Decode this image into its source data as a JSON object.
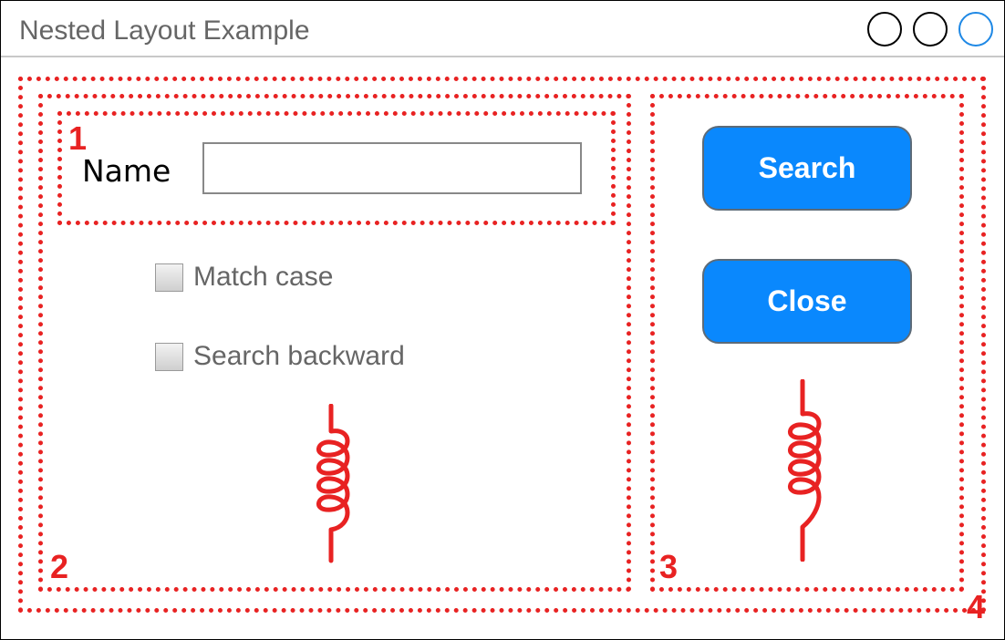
{
  "window": {
    "title": "Nested Layout Example"
  },
  "regions": {
    "region1_label": "1",
    "region2_label": "2",
    "region3_label": "3",
    "region4_label": "4"
  },
  "form": {
    "name_label": "Name",
    "name_value": "",
    "match_case_label": "Match case",
    "match_case_checked": false,
    "search_backward_label": "Search backward",
    "search_backward_checked": false
  },
  "buttons": {
    "search_label": "Search",
    "close_label": "Close"
  },
  "colors": {
    "annotation": "#e82222",
    "button": "#0a88fd",
    "active_window_control": "#1e88e5"
  }
}
